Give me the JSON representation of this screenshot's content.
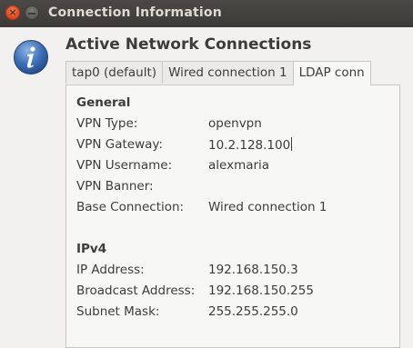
{
  "window": {
    "title": "Connection Information"
  },
  "heading": "Active Network Connections",
  "tabs": [
    {
      "label": "tap0 (default)"
    },
    {
      "label": "Wired connection 1"
    },
    {
      "label": "LDAP conn"
    }
  ],
  "general": {
    "title": "General",
    "rows": [
      {
        "label": "VPN Type:",
        "value": "openvpn"
      },
      {
        "label": "VPN Gateway:",
        "value": "10.2.128.100"
      },
      {
        "label": "VPN Username:",
        "value": "alexmaria"
      },
      {
        "label": "VPN Banner:",
        "value": ""
      },
      {
        "label": "Base Connection:",
        "value": "Wired connection 1"
      }
    ]
  },
  "ipv4": {
    "title": "IPv4",
    "rows": [
      {
        "label": "IP Address:",
        "value": "192.168.150.3"
      },
      {
        "label": "Broadcast Address:",
        "value": "192.168.150.255"
      },
      {
        "label": "Subnet Mask:",
        "value": "255.255.255.0"
      }
    ]
  },
  "icons": {
    "close": "close-icon",
    "minimize": "minimize-icon",
    "info": "info-icon"
  },
  "colors": {
    "titlebar": "#3c3b37",
    "close_button": "#e0461b",
    "info_icon": "#3465a4"
  }
}
